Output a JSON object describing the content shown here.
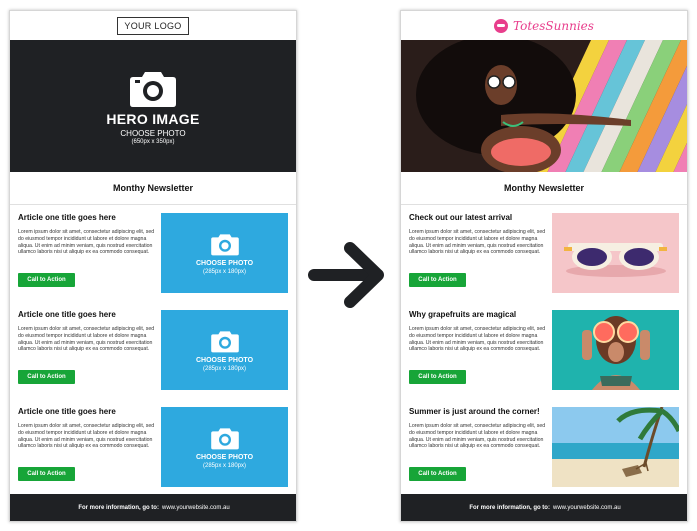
{
  "left_template": {
    "logo_text": "YOUR LOGO",
    "hero": {
      "title": "HERO IMAGE",
      "subtitle": "CHOOSE PHOTO",
      "dims": "(650px x 350px)"
    },
    "newsletter_title": "Monthy Newsletter",
    "articles": [
      {
        "title": "Article one title goes here",
        "body": "Lorem ipsum dolor sit amet, consectetur adipiscing elit, sed do eiusmod tempor incididunt ut labore et dolore magna aliqua. Ut enim ad minim veniam, quis nostrud exercitation ullamco laboris nisi ut aliquip ex ea commodo consequat.",
        "cta": "Call to Action",
        "photo_label": "CHOOSE PHOTO",
        "photo_dims": "(285px x 180px)"
      },
      {
        "title": "Article one title goes here",
        "body": "Lorem ipsum dolor sit amet, consectetur adipiscing elit, sed do eiusmod tempor incididunt ut labore et dolore magna aliqua. Ut enim ad minim veniam, quis nostrud exercitation ullamco laboris nisi ut aliquip ex ea commodo consequat.",
        "cta": "Call to Action",
        "photo_label": "CHOOSE PHOTO",
        "photo_dims": "(285px x 180px)"
      },
      {
        "title": "Article one title goes here",
        "body": "Lorem ipsum dolor sit amet, consectetur adipiscing elit, sed do eiusmod tempor incididunt ut labore et dolore magna aliqua. Ut enim ad minim veniam, quis nostrud exercitation ullamco laboris nisi ut aliquip ex ea commodo consequat.",
        "cta": "Call to Action",
        "photo_label": "CHOOSE PHOTO",
        "photo_dims": "(285px x 180px)"
      }
    ],
    "footer": {
      "label": "For more information, go to:",
      "url": "www.yourwebsite.com.au"
    }
  },
  "right_example": {
    "brand_name": "TotesSunnies",
    "newsletter_title": "Monthy Newsletter",
    "articles": [
      {
        "title": "Check out our latest arrival",
        "body": "Lorem ipsum dolor sit amet, consectetur adipiscing elit, sed do eiusmod tempor incididunt ut labore et dolore magna aliqua. Ut enim ad minim veniam, quis nostrud exercitation ullamco laboris nisi ut aliquip ex ea commodo consequat.",
        "cta": "Call to Action"
      },
      {
        "title": "Why grapefruits are magical",
        "body": "Lorem ipsum dolor sit amet, consectetur adipiscing elit, sed do eiusmod tempor incididunt ut labore et dolore magna aliqua. Ut enim ad minim veniam, quis nostrud exercitation ullamco laboris nisi ut aliquip ex ea commodo consequat.",
        "cta": "Call to Action"
      },
      {
        "title": "Summer is just around the corner!",
        "body": "Lorem ipsum dolor sit amet, consectetur adipiscing elit, sed do eiusmod tempor incididunt ut labore et dolore magna aliqua. Ut enim ad minim veniam, quis nostrud exercitation ullamco laboris nisi ut aliquip ex ea commodo consequat.",
        "cta": "Call to Action"
      }
    ],
    "footer": {
      "label": "For more information, go to:",
      "url": "www.yourwebsite.com.au"
    }
  },
  "colors": {
    "dark": "#1f2124",
    "placeholder_blue": "#2ea9df",
    "cta_green": "#17a538",
    "brand_pink": "#e83e8c"
  },
  "icons": {
    "camera": "camera-icon",
    "arrow": "arrow-right-icon"
  }
}
